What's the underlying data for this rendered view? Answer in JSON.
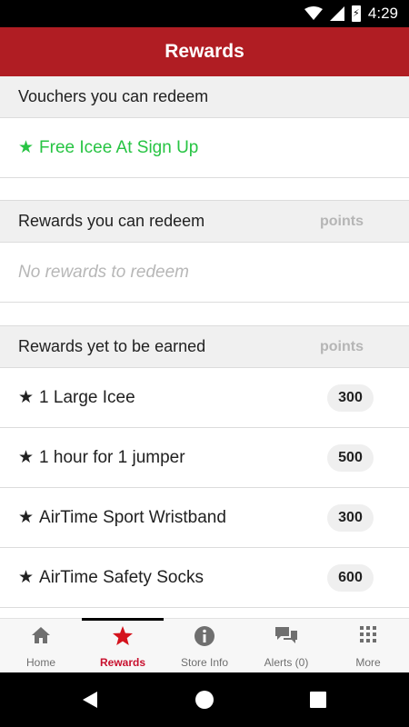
{
  "status_bar": {
    "time": "4:29",
    "battery_glyph": "⚡"
  },
  "header": {
    "title": "Rewards"
  },
  "sections": {
    "vouchers": {
      "title": "Vouchers you can redeem",
      "items": [
        {
          "star": "★",
          "label": "Free Icee At Sign Up"
        }
      ]
    },
    "redeemable": {
      "title": "Rewards you can redeem",
      "points_label": "points",
      "empty_text": "No rewards to redeem"
    },
    "unearned": {
      "title": "Rewards yet to be earned",
      "points_label": "points",
      "items": [
        {
          "star": "★",
          "label": "1 Large Icee",
          "points": "300"
        },
        {
          "star": "★",
          "label": "1 hour for 1 jumper",
          "points": "500"
        },
        {
          "star": "★",
          "label": "AirTime Sport Wristband",
          "points": "300"
        },
        {
          "star": "★",
          "label": "AirTime Safety Socks",
          "points": "600"
        }
      ]
    }
  },
  "bottom_nav": [
    {
      "label": "Home",
      "icon": "home-icon"
    },
    {
      "label": "Rewards",
      "icon": "star-icon",
      "active": true
    },
    {
      "label": "Store Info",
      "icon": "info-icon"
    },
    {
      "label": "Alerts (0)",
      "icon": "chat-bubbles-icon"
    },
    {
      "label": "More",
      "icon": "grid-icon"
    }
  ],
  "colors": {
    "app_bar": "#b01d23",
    "voucher_text": "#27c443",
    "active_nav": "#c8102e",
    "section_bg": "#f0f0f0"
  }
}
